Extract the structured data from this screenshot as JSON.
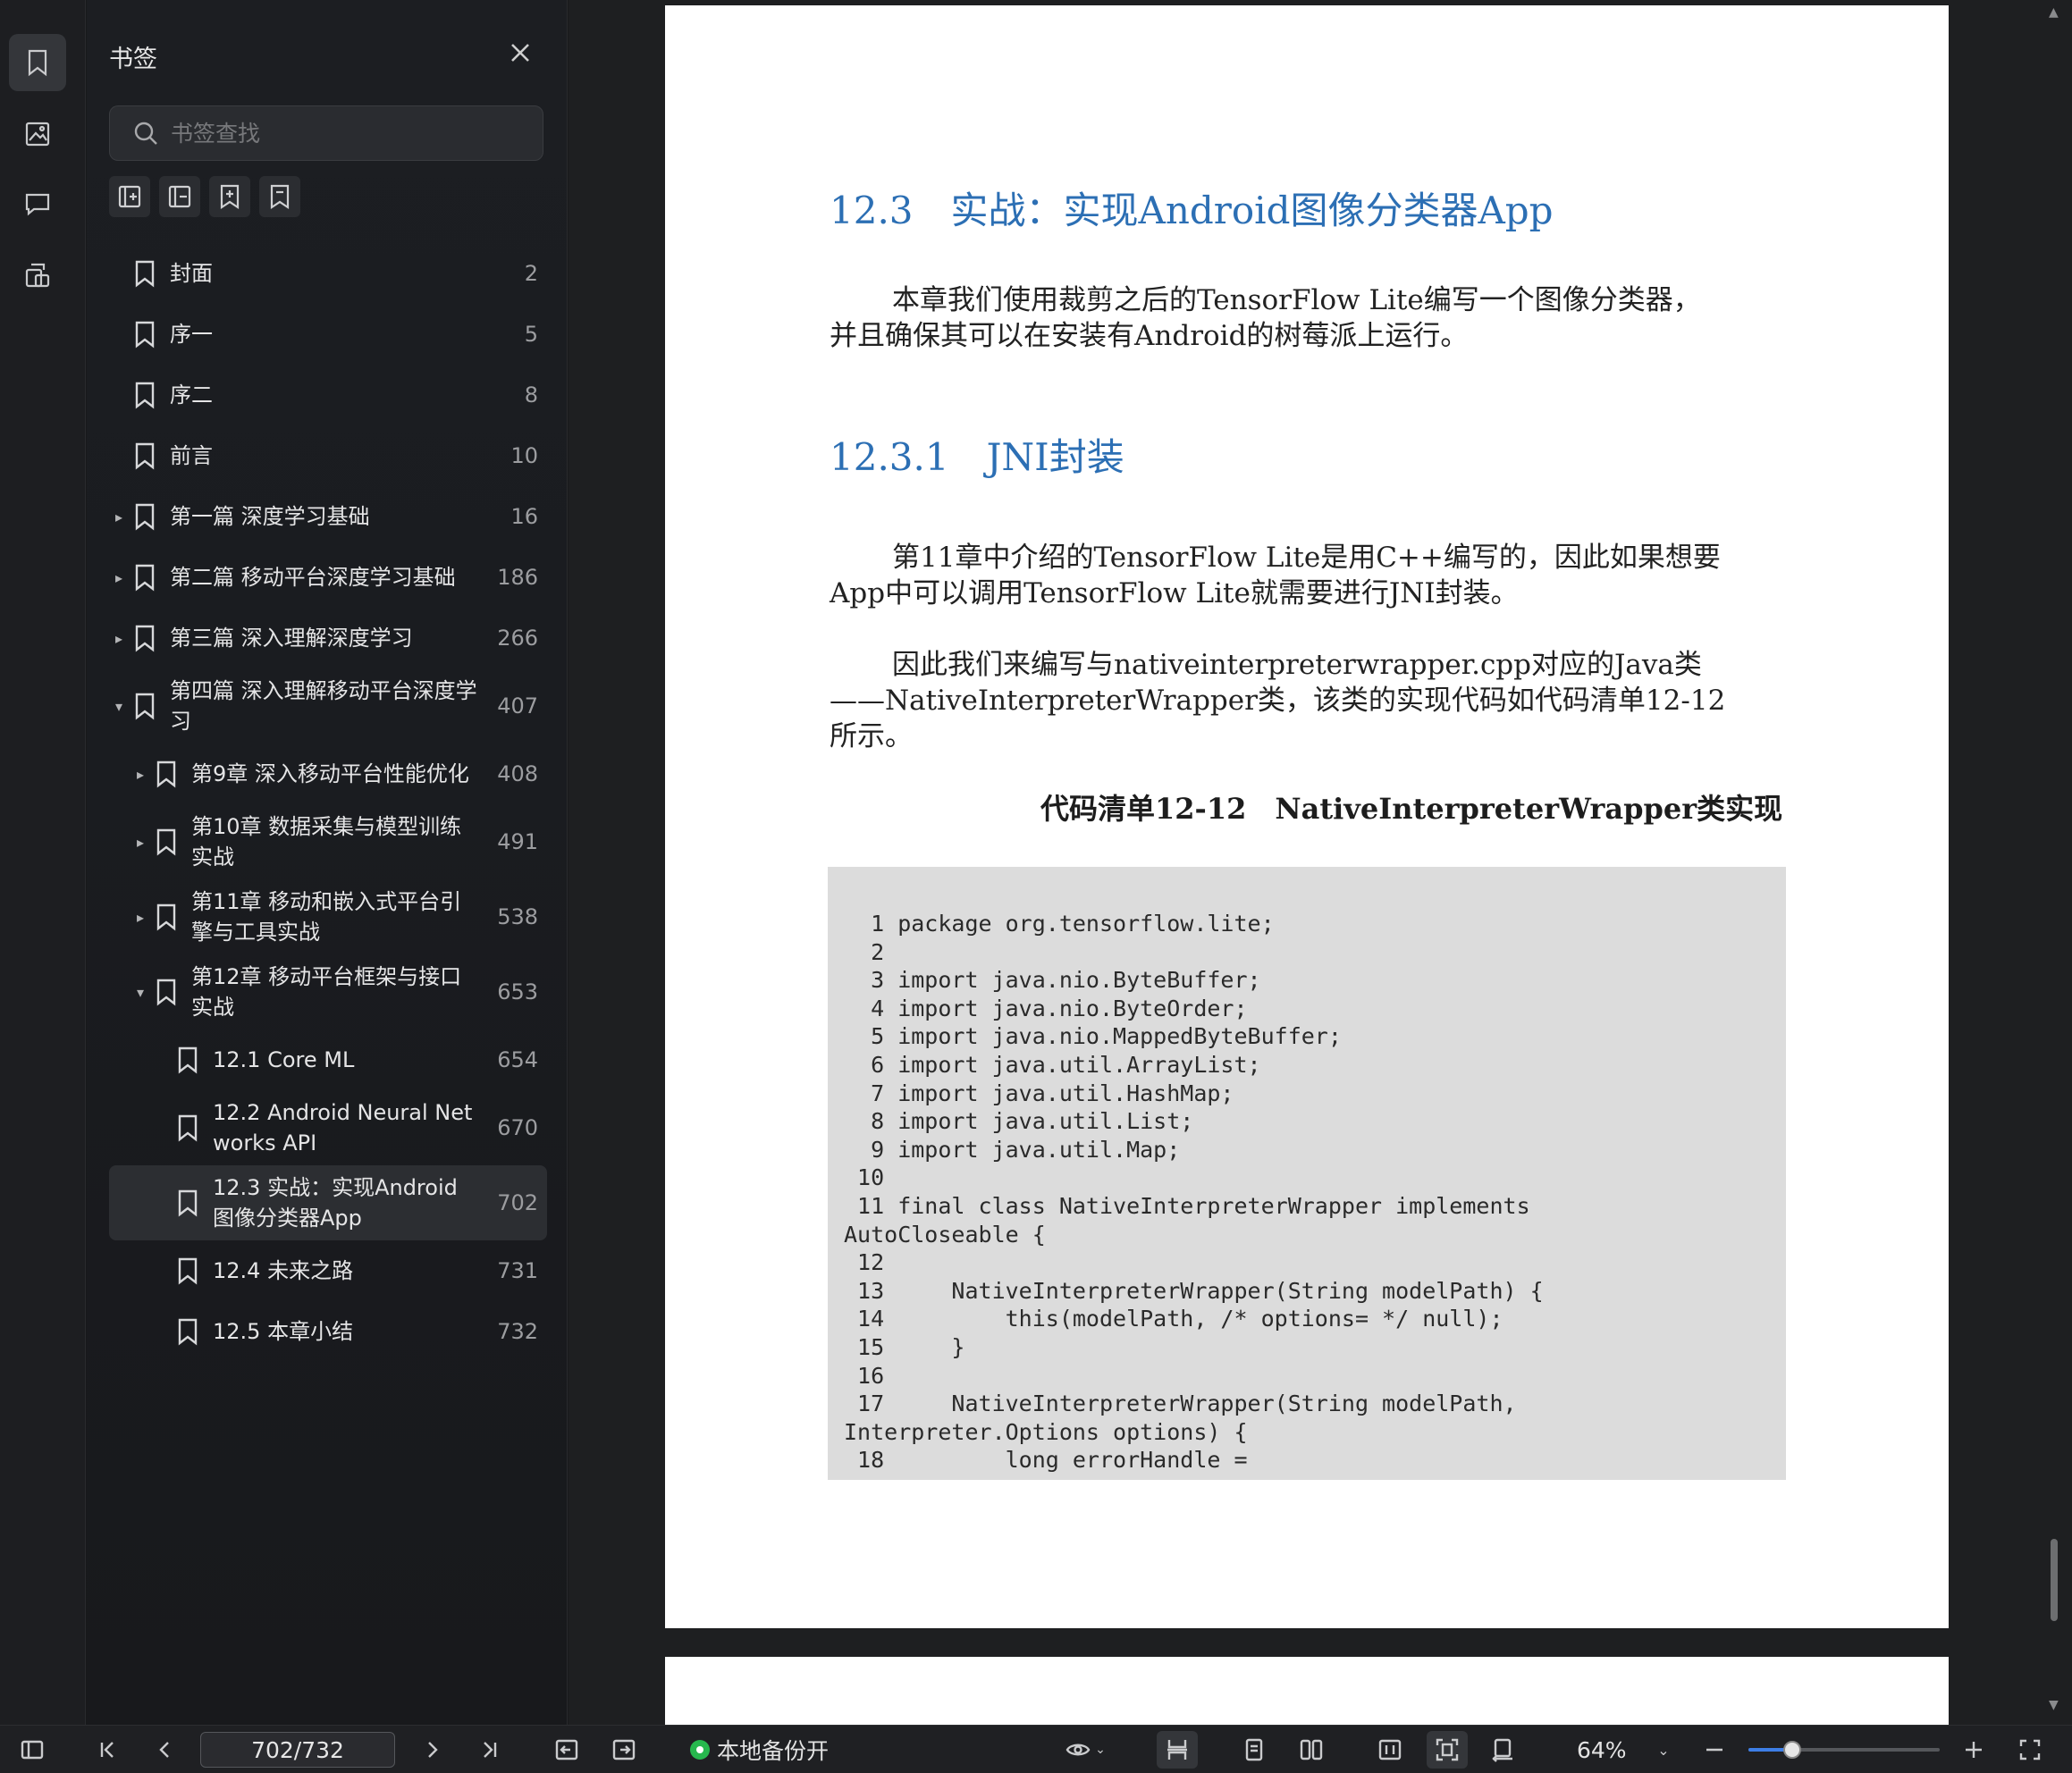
{
  "panel": {
    "title": "书签",
    "search_placeholder": "书签查找"
  },
  "bookmarks": [
    {
      "label": "封面",
      "page": "2",
      "level": 0,
      "caret": ""
    },
    {
      "label": "序一",
      "page": "5",
      "level": 0,
      "caret": ""
    },
    {
      "label": "序二",
      "page": "8",
      "level": 0,
      "caret": ""
    },
    {
      "label": "前言",
      "page": "10",
      "level": 0,
      "caret": ""
    },
    {
      "label": "第一篇 深度学习基础",
      "page": "16",
      "level": 0,
      "caret": "▸"
    },
    {
      "label": "第二篇 移动平台深度学习基础",
      "page": "186",
      "level": 0,
      "caret": "▸"
    },
    {
      "label": "第三篇 深入理解深度学习",
      "page": "266",
      "level": 0,
      "caret": "▸"
    },
    {
      "label": "第四篇 深入理解移动平台深度学习",
      "page": "407",
      "level": 0,
      "caret": "▾"
    },
    {
      "label": "第9章 深入移动平台性能优化",
      "page": "408",
      "level": 1,
      "caret": "▸"
    },
    {
      "label": "第10章 数据采集与模型训练实战",
      "page": "491",
      "level": 1,
      "caret": "▸"
    },
    {
      "label": "第11章 移动和嵌入式平台引擎与工具实战",
      "page": "538",
      "level": 1,
      "caret": "▸"
    },
    {
      "label": "第12章 移动平台框架与接口实战",
      "page": "653",
      "level": 1,
      "caret": "▾"
    },
    {
      "label": "12.1 Core ML",
      "page": "654",
      "level": 2,
      "caret": ""
    },
    {
      "label": "12.2 Android Neural Networks API",
      "page": "670",
      "level": 2,
      "caret": ""
    },
    {
      "label": "12.3 实战：实现Android图像分类器App",
      "page": "702",
      "level": 2,
      "caret": "",
      "selected": true
    },
    {
      "label": "12.4 未来之路",
      "page": "731",
      "level": 2,
      "caret": ""
    },
    {
      "label": "12.5 本章小结",
      "page": "732",
      "level": 2,
      "caret": ""
    }
  ],
  "document": {
    "section_title": "12.3　实战：实现Android图像分类器App",
    "para1_l1": "本章我们使用裁剪之后的TensorFlow Lite编写一个图像分类器，",
    "para1_l2": "并且确保其可以在安装有Android的树莓派上运行。",
    "subsection_title": "12.3.1　JNI封装",
    "para2_l1": "第11章中介绍的TensorFlow Lite是用C++编写的，因此如果想要",
    "para2_l2": "App中可以调用TensorFlow Lite就需要进行JNI封装。",
    "para3_l1": "因此我们来编写与nativeinterpreterwrapper.cpp对应的Java类",
    "para3_l2": "——NativeInterpreterWrapper类，该类的实现代码如代码清单12-12",
    "para3_l3": "所示。",
    "code_caption": "代码清单12-12　NativeInterpreterWrapper类实现",
    "code_lines": [
      "  1 package org.tensorflow.lite;",
      "  2",
      "  3 import java.nio.ByteBuffer;",
      "  4 import java.nio.ByteOrder;",
      "  5 import java.nio.MappedByteBuffer;",
      "  6 import java.util.ArrayList;",
      "  7 import java.util.HashMap;",
      "  8 import java.util.List;",
      "  9 import java.util.Map;",
      " 10",
      " 11 final class NativeInterpreterWrapper implements",
      "AutoCloseable {",
      " 12",
      " 13     NativeInterpreterWrapper(String modelPath) {",
      " 14         this(modelPath, /* options= */ null);",
      " 15     }",
      " 16",
      " 17     NativeInterpreterWrapper(String modelPath,",
      "Interpreter.Options options) {",
      " 18         long errorHandle ="
    ]
  },
  "bottom_bar": {
    "page_indicator": "702/732",
    "backup_label": "本地备份开",
    "zoom": "64%",
    "zoom_fraction": 0.23
  },
  "colors": {
    "heading_blue": "#2c6fb4",
    "backup_green": "#27b84e",
    "slider_blue": "#3d7ee6"
  }
}
